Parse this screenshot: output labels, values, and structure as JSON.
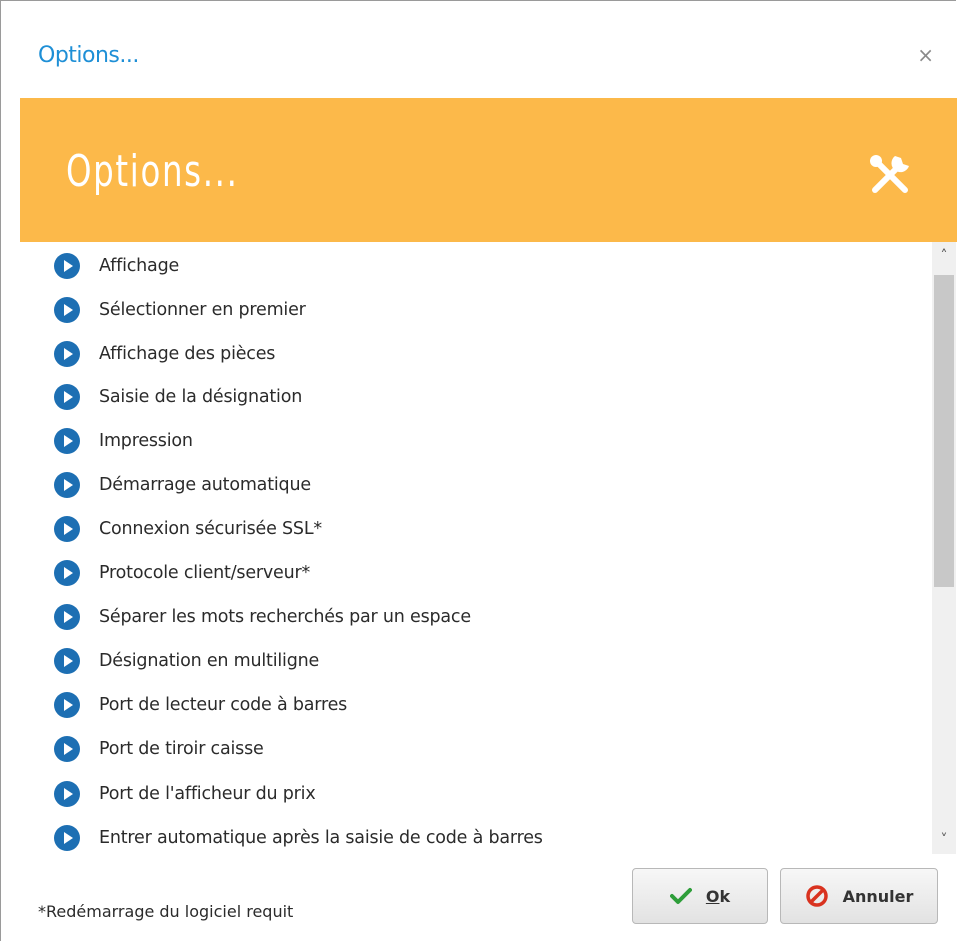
{
  "window": {
    "title": "Options...",
    "close_label": "×"
  },
  "banner": {
    "title": "Options...",
    "icon": "tools-icon",
    "color": "#fcb94a"
  },
  "options": [
    {
      "label": "Affichage"
    },
    {
      "label": "Sélectionner en premier"
    },
    {
      "label": "Affichage des pièces"
    },
    {
      "label": "Saisie de la désignation"
    },
    {
      "label": "Impression"
    },
    {
      "label": "Démarrage automatique"
    },
    {
      "label": "Connexion sécurisée SSL*"
    },
    {
      "label": "Protocole client/serveur*"
    },
    {
      "label": "Séparer les mots recherchés par un espace"
    },
    {
      "label": "Désignation en multiligne"
    },
    {
      "label": "Port de lecteur code à barres"
    },
    {
      "label": "Port de tiroir caisse"
    },
    {
      "label": "Port de l'afficheur du prix"
    },
    {
      "label": "Entrer automatique après la saisie de code à barres"
    }
  ],
  "footer": {
    "note": "*Redémarrage du logiciel requit",
    "ok_label_first": "O",
    "ok_label_rest": "k",
    "cancel_label": "Annuler"
  },
  "colors": {
    "title_blue": "#1e8fd6",
    "bullet_blue": "#1d6fb3",
    "ok_green": "#2e9e3a",
    "cancel_red": "#d9321f"
  }
}
